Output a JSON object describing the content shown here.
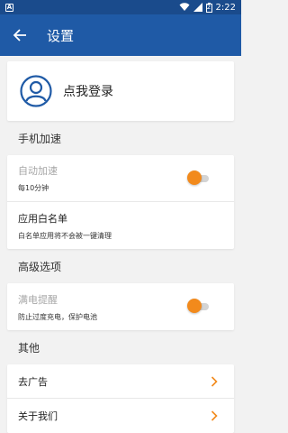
{
  "status_bar": {
    "sim_label": "A",
    "battery_level": "2",
    "time": "2:22"
  },
  "app_bar": {
    "title": "设置"
  },
  "login": {
    "label": "点我登录"
  },
  "sections": {
    "speed": {
      "title": "手机加速",
      "auto_speed": {
        "title": "自动加速",
        "subtitle": "每10分钟",
        "enabled": false
      },
      "whitelist": {
        "title": "应用白名单",
        "subtitle": "白名单应用将不会被一键清理"
      }
    },
    "advanced": {
      "title": "高级选项",
      "full_charge": {
        "title": "满电提醒",
        "subtitle": "防止过度充电，保护电池",
        "enabled": false
      }
    },
    "other": {
      "title": "其他",
      "remove_ads": {
        "title": "去广告"
      },
      "about": {
        "title": "关于我们"
      }
    }
  },
  "colors": {
    "status_bar": "#1a4b8c",
    "app_bar": "#1f5aa6",
    "accent_orange": "#f28a1c",
    "avatar_blue": "#1f5aa6"
  }
}
